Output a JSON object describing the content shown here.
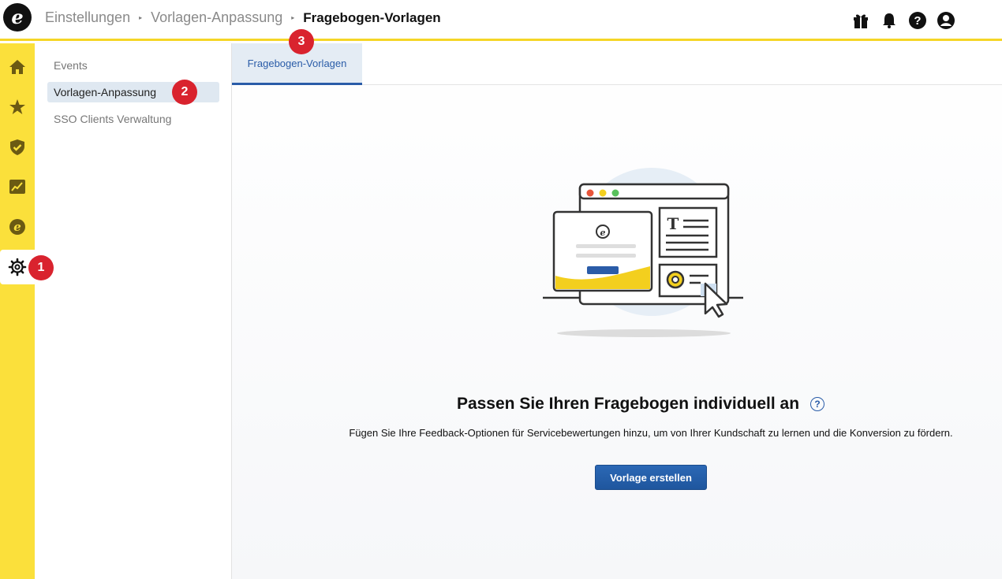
{
  "header": {
    "logo_letter": "e",
    "breadcrumb": [
      "Einstellungen",
      "Vorlagen-Anpassung",
      "Fragebogen-Vorlagen"
    ],
    "separator": "▸",
    "icons": [
      "gift-icon",
      "bell-icon",
      "help-icon",
      "account-icon"
    ]
  },
  "rail": {
    "icons": [
      "home-icon",
      "star-icon",
      "shield-icon",
      "chart-icon",
      "e-logo-icon",
      "gear-icon"
    ],
    "active": "gear-icon",
    "color": "#fbe03b"
  },
  "sidebar": {
    "items": [
      {
        "label": "Events"
      },
      {
        "label": "Vorlagen-Anpassung",
        "active": true
      },
      {
        "label": "SSO Clients Verwaltung"
      }
    ]
  },
  "badges": [
    "1",
    "2",
    "3"
  ],
  "main": {
    "tabs": [
      {
        "label": "Fragebogen-Vorlagen",
        "active": true
      }
    ],
    "title": "Passen Sie Ihren Fragebogen individuell an",
    "subtitle": "Fügen Sie Ihre Feedback-Optionen für Servicebewertungen hinzu, um von Ihrer Kundschaft zu lernen und die Konversion zu fördern.",
    "cta_label": "Vorlage erstellen",
    "help_symbol": "?"
  },
  "colors": {
    "accent_blue": "#2a5ca8",
    "badge_red": "#d9232e",
    "brand_yellow": "#fbe03b"
  }
}
